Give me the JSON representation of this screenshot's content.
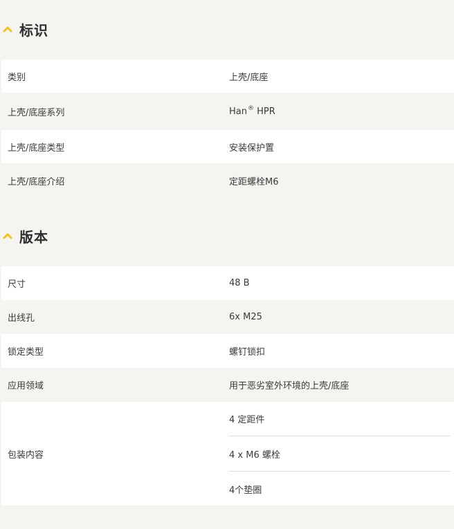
{
  "colors": {
    "accent": "#f2c21a",
    "page_bg": "#f5f4f0",
    "row_alt": "#ffffff"
  },
  "identification": {
    "icon": "chevron-up-icon",
    "title": "标识",
    "rows": [
      {
        "label": "类别",
        "value": "上壳/底座"
      },
      {
        "label": "上壳/底座系列",
        "value": "Han",
        "value_sup": "®",
        "value_suffix": " HPR"
      },
      {
        "label": "上壳/底座类型",
        "value": "安装保护置"
      },
      {
        "label": "上壳/底座介绍",
        "value": "定距螺栓M6"
      }
    ]
  },
  "version": {
    "icon": "chevron-up-icon",
    "title": "版本",
    "rows": [
      {
        "label": "尺寸",
        "value": "48 B"
      },
      {
        "label": "出线孔",
        "value": "6x M25"
      },
      {
        "label": "锁定类型",
        "value": "螺钉锁扣"
      },
      {
        "label": "应用领域",
        "value": "用于恶劣室外环境的上壳/底座"
      }
    ],
    "package": {
      "label": "包装内容",
      "items": [
        "4 定距件",
        "4 x M6 螺栓",
        "4个垫圈"
      ]
    }
  }
}
